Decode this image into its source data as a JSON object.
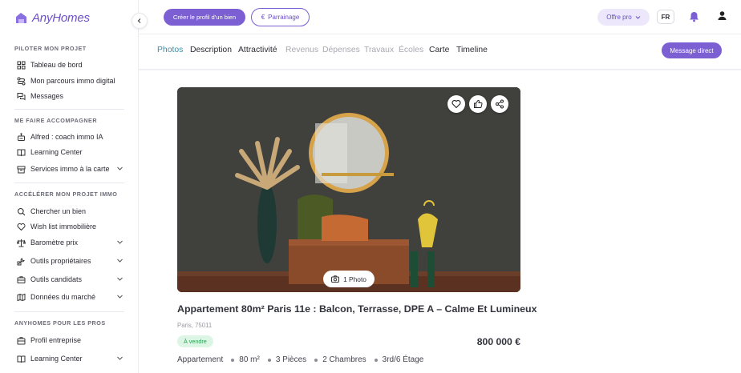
{
  "app": {
    "logo_text": "AnyHomes",
    "brand_color": "#7b5fd3"
  },
  "sidebar": {
    "sections": [
      {
        "title": "PILOTER MON PROJET"
      },
      {
        "title": "ME FAIRE ACCOMPAGNER"
      },
      {
        "title": "ACCÉLÉRER MON PROJET IMMO"
      },
      {
        "title": "ANYHOMES POUR LES PROS"
      }
    ],
    "items": [
      {
        "label": "Tableau de bord",
        "icon": "grid-icon"
      },
      {
        "label": "Mon parcours immo digital",
        "icon": "route-icon"
      },
      {
        "label": "Messages",
        "icon": "chat-icon"
      },
      {
        "label": "Alfred : coach immo IA",
        "icon": "robot-icon"
      },
      {
        "label": "Learning Center",
        "icon": "book-icon"
      },
      {
        "label": "Services immo à la carte",
        "icon": "box-icon",
        "has_chevron": true
      },
      {
        "label": "Chercher un bien",
        "icon": "search-icon"
      },
      {
        "label": "Wish list immobilière",
        "icon": "heart-icon"
      },
      {
        "label": "Baromètre prix",
        "icon": "scale-icon",
        "has_chevron": true
      },
      {
        "label": "Outils propriétaires",
        "icon": "tools-icon",
        "has_chevron": true
      },
      {
        "label": "Outils candidats",
        "icon": "briefcase-icon",
        "has_chevron": true
      },
      {
        "label": "Données du marché",
        "icon": "map-icon",
        "has_chevron": true
      },
      {
        "label": "Profil entreprise",
        "icon": "building-icon"
      },
      {
        "label": "Learning Center",
        "icon": "book-icon",
        "has_chevron": true
      }
    ]
  },
  "topbar": {
    "create_profile": "Créer le profil d'un bien",
    "referral": "Parrainage",
    "offer": "Offre pro",
    "language": "FR"
  },
  "tabs": [
    {
      "label": "Photos",
      "state": "active"
    },
    {
      "label": "Description",
      "state": "normal"
    },
    {
      "label": "Attractivité",
      "state": "normal"
    },
    {
      "label": "Revenus",
      "state": "disabled"
    },
    {
      "label": "Dépenses",
      "state": "disabled"
    },
    {
      "label": "Travaux",
      "state": "disabled"
    },
    {
      "label": "Écoles",
      "state": "disabled"
    },
    {
      "label": "Carte",
      "state": "normal"
    },
    {
      "label": "Timeline",
      "state": "normal"
    }
  ],
  "message_button": "Message direct",
  "listing": {
    "photo_count": "1 Photo",
    "title": "Appartement 80m² Paris 11e : Balcon, Terrasse, DPE A – Calme Et Lumineux",
    "address": "Paris, 75011",
    "status": "À vendre",
    "price": "800 000 €",
    "features": [
      "Appartement",
      "80 m²",
      "3 Pièces",
      "2 Chambres",
      "3rd/6 Étage"
    ]
  },
  "colors": {
    "active_tab": "#3a8fa8",
    "badge_bg": "#dcf5e4",
    "badge_text": "#2e9d55"
  }
}
